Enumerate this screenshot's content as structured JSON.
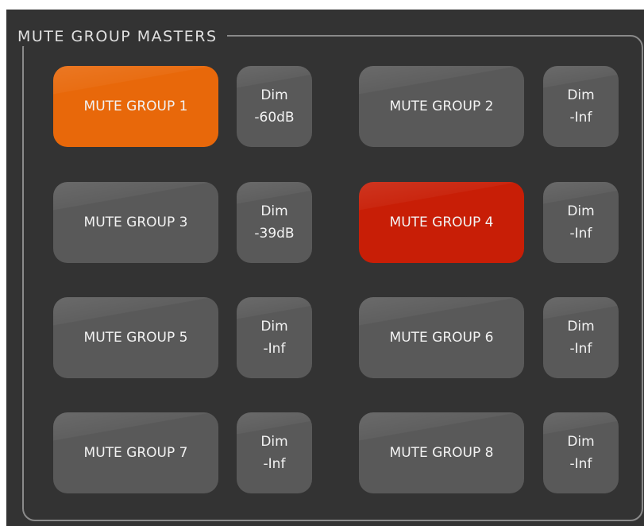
{
  "panel": {
    "title": "MUTE GROUP MASTERS"
  },
  "colors": {
    "panel_bg": "#333333",
    "button_inactive": "#595959",
    "button_active_orange": "#e8680a",
    "button_active_red": "#c81e06",
    "text": "#f2f2f2"
  },
  "groups": [
    {
      "label": "MUTE GROUP 1",
      "state": "orange",
      "dim_label": "Dim",
      "dim_value": "-60dB"
    },
    {
      "label": "MUTE GROUP 2",
      "state": "inactive",
      "dim_label": "Dim",
      "dim_value": "-Inf"
    },
    {
      "label": "MUTE GROUP 3",
      "state": "inactive",
      "dim_label": "Dim",
      "dim_value": "-39dB"
    },
    {
      "label": "MUTE GROUP 4",
      "state": "red",
      "dim_label": "Dim",
      "dim_value": "-Inf"
    },
    {
      "label": "MUTE GROUP 5",
      "state": "inactive",
      "dim_label": "Dim",
      "dim_value": "-Inf"
    },
    {
      "label": "MUTE GROUP 6",
      "state": "inactive",
      "dim_label": "Dim",
      "dim_value": "-Inf"
    },
    {
      "label": "MUTE GROUP 7",
      "state": "inactive",
      "dim_label": "Dim",
      "dim_value": "-Inf"
    },
    {
      "label": "MUTE GROUP 8",
      "state": "inactive",
      "dim_label": "Dim",
      "dim_value": "-Inf"
    }
  ]
}
